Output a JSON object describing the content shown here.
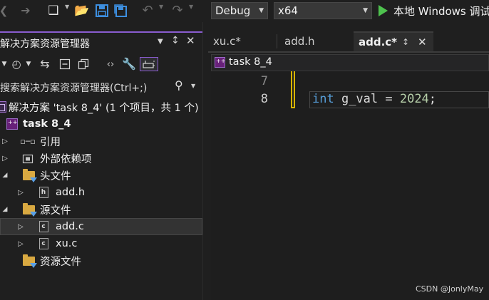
{
  "toolbar": {
    "config_value": "Debug",
    "platform_value": "x64",
    "run_label": "本地 Windows 调试器"
  },
  "solution_explorer": {
    "title": "解决方案资源管理器",
    "search_placeholder": "搜索解决方案资源管理器(Ctrl+;)",
    "solution_label": "解决方案 'task 8_4' (1 个项目，共 1 个)",
    "items": [
      {
        "label": "task 8_4",
        "type": "project",
        "expander": "",
        "bold": true
      },
      {
        "label": "引用",
        "type": "references",
        "expander": "▷"
      },
      {
        "label": "外部依赖项",
        "type": "external",
        "expander": "▷"
      },
      {
        "label": "头文件",
        "type": "folder",
        "expander": "◢"
      },
      {
        "label": "add.h",
        "type": "header",
        "expander": "▷"
      },
      {
        "label": "源文件",
        "type": "folder",
        "expander": "◢"
      },
      {
        "label": "add.c",
        "type": "source",
        "expander": "▷",
        "selected": true
      },
      {
        "label": "xu.c",
        "type": "source",
        "expander": "▷"
      },
      {
        "label": "资源文件",
        "type": "folder",
        "expander": ""
      }
    ]
  },
  "editor": {
    "tabs": [
      {
        "label": "xu.c*",
        "active": false
      },
      {
        "label": "add.h",
        "active": false
      },
      {
        "label": "add.c*",
        "active": true
      }
    ],
    "nav_scope": "task 8_4",
    "lines": [
      {
        "number": "7",
        "text": ""
      },
      {
        "number": "8",
        "keyword": "int",
        "rest": " g_val = ",
        "number_literal": "2024",
        "tail": ";"
      }
    ]
  },
  "watermark": "CSDN @JonlyMay",
  "colors": {
    "accent": "#8a5ccf",
    "keyword": "#569cd6",
    "number": "#b5cea8",
    "change_bar": "#d7b400",
    "run": "#4ec24e"
  }
}
